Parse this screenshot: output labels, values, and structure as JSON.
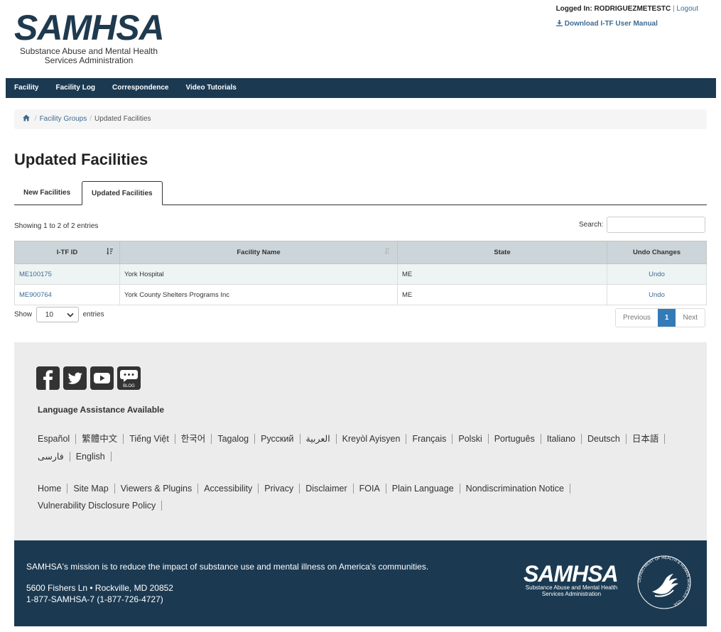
{
  "header": {
    "logo_word": "SAMHSA",
    "logo_sub": "Substance Abuse and Mental Health Services Administration",
    "logged_in_label": "Logged In:",
    "username": "RODRIGUEZMETESTC",
    "separator": "|",
    "logout": "Logout",
    "manual": "Download I-TF User Manual"
  },
  "nav": [
    "Facility",
    "Facility Log",
    "Correspondence",
    "Video Tutorials"
  ],
  "breadcrumb": {
    "groups": "Facility Groups",
    "current": "Updated Facilities"
  },
  "page_title": "Updated Facilities",
  "tabs": [
    "New Facilities",
    "Updated Facilities"
  ],
  "table_info": "Showing 1 to 2 of 2 entries",
  "search_label": "Search:",
  "columns": [
    "I-TF ID",
    "Facility Name",
    "State",
    "Undo Changes"
  ],
  "rows": [
    {
      "id": "ME100175",
      "name": "York Hospital",
      "state": "ME",
      "undo": "Undo"
    },
    {
      "id": "ME900764",
      "name": "York County Shelters Programs Inc",
      "state": "ME",
      "undo": "Undo"
    }
  ],
  "length": {
    "show": "Show",
    "value": "10",
    "entries": "entries"
  },
  "pager": {
    "prev": "Previous",
    "page": "1",
    "next": "Next"
  },
  "footer": {
    "lang_title": "Language Assistance Available",
    "blog": "BLOG",
    "languages": [
      "Español",
      "繁體中文",
      "Tiếng Việt",
      "한국어",
      "Tagalog",
      "Русский",
      "العربية",
      "Kreyòl Ayisyen",
      "Français",
      "Polski",
      "Português",
      "Italiano",
      "Deutsch",
      "日本語",
      "فارسی",
      "English"
    ],
    "links": [
      "Home",
      "Site Map",
      "Viewers & Plugins",
      "Accessibility",
      "Privacy",
      "Disclaimer",
      "FOIA",
      "Plain Language",
      "Nondiscrimination Notice",
      "Vulnerability Disclosure Policy"
    ],
    "mission": "SAMHSA's mission is to reduce the impact of substance use and mental illness on America's communities.",
    "address": "5600 Fishers Ln • Rockville, MD 20852",
    "phone": "1-877-SAMHSA-7 (1-877-726-4727)",
    "logo_word": "SAMHSA",
    "logo_sub": "Substance Abuse and Mental Health Services Administration",
    "hhs_seal_text": "DEPARTMENT OF HEALTH & HUMAN SERVICES · USA"
  }
}
